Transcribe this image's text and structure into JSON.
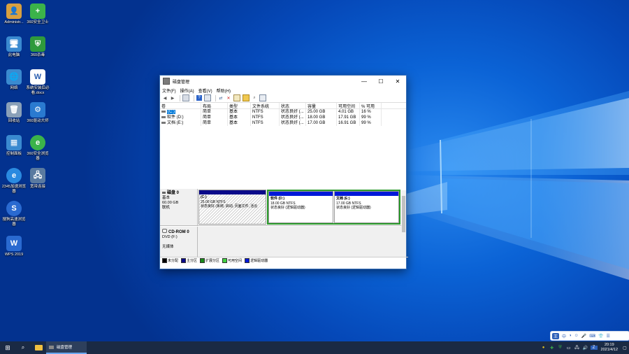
{
  "desktop": {
    "icons": [
      {
        "label": "Administr...",
        "glyph": "👤",
        "color": "#d8a040"
      },
      {
        "label": "360安全卫士",
        "glyph": "+",
        "color": "#3bb34a"
      },
      {
        "label": "此电脑",
        "glyph": "🖥",
        "color": "#3a8ad0"
      },
      {
        "label": "360杀毒",
        "glyph": "⛨",
        "color": "#2f9a3c"
      },
      {
        "label": "网络",
        "glyph": "🌐",
        "color": "#3a8ad0"
      },
      {
        "label": "系统安装后必看.docx",
        "glyph": "W",
        "color": "#2b5fb0"
      },
      {
        "label": "回收站",
        "glyph": "🗑",
        "color": "#8aa0b8"
      },
      {
        "label": "360驱动大师",
        "glyph": "⚙",
        "color": "#2a7ad0"
      },
      {
        "label": "控制面板",
        "glyph": "▦",
        "color": "#3a8ad0"
      },
      {
        "label": "360安全浏览器",
        "glyph": "e",
        "color": "#3bb34a"
      },
      {
        "label": "2345加速浏览器",
        "glyph": "e",
        "color": "#2a8ae0"
      },
      {
        "label": "宽带连接",
        "glyph": "🖧",
        "color": "#5a7aa0"
      },
      {
        "label": "搜狗高速浏览器",
        "glyph": "S",
        "color": "#2a6ad0"
      },
      {
        "label": "WPS 2019",
        "glyph": "W",
        "color": "#2a6ad0"
      }
    ]
  },
  "window": {
    "title": "磁盘管理",
    "controls": {
      "minimize": "—",
      "maximize": "☐",
      "close": "✕"
    },
    "menu": [
      "文件(F)",
      "操作(A)",
      "查看(V)",
      "帮助(H)"
    ],
    "toolbar_icons": [
      "back-icon",
      "forward-icon",
      "sep",
      "list-icon",
      "sep",
      "help-icon",
      "grid-icon",
      "sep",
      "connect-icon",
      "delete-icon",
      "properties-icon",
      "folder-icon",
      "search-icon",
      "view-icon"
    ],
    "table": {
      "headers": [
        "卷",
        "布局",
        "类型",
        "文件系统",
        "状态",
        "容量",
        "可用空间",
        "% 可用"
      ],
      "rows": [
        {
          "name": "(C:)",
          "selected": true,
          "cells": [
            "简单",
            "基本",
            "NTFS",
            "状态良好 (...",
            "25.00 GB",
            "4.01 GB",
            "16 %"
          ]
        },
        {
          "name": "软件 (D:)",
          "selected": false,
          "cells": [
            "简单",
            "基本",
            "NTFS",
            "状态良好 (...",
            "18.00 GB",
            "17.91 GB",
            "99 %"
          ]
        },
        {
          "name": "文档 (E:)",
          "selected": false,
          "cells": [
            "简单",
            "基本",
            "NTFS",
            "状态良好 (...",
            "17.00 GB",
            "16.91 GB",
            "99 %"
          ]
        }
      ]
    },
    "disks": [
      {
        "name": "磁盘 0",
        "type": "基本",
        "size": "60.00 GB",
        "status": "联机",
        "partitions": [
          {
            "title": "(C:)",
            "size": "25.00 GB NTFS",
            "status": "状态良好 (系统, 启动, 页面文件, 活云",
            "color": "#0a0a8a",
            "style": "hatch"
          },
          {
            "title": "软件  (D:)",
            "size": "18.00 GB NTFS",
            "status": "状态良好 (逻辑驱动器)",
            "color": "#0018d8",
            "style": "logical"
          },
          {
            "title": "文档  (E:)",
            "size": "17.00 GB NTFS",
            "status": "状态良好 (逻辑驱动器)",
            "color": "#0018d8",
            "style": "logical"
          }
        ]
      },
      {
        "name": "CD-ROM 0",
        "type": "DVD (F:)",
        "size": "",
        "status": "无媒体",
        "partitions": []
      }
    ],
    "legend": [
      {
        "label": "未分配",
        "color": "#000000"
      },
      {
        "label": "主分区",
        "color": "#0a0a8a"
      },
      {
        "label": "扩展分区",
        "color": "#1a8a1a"
      },
      {
        "label": "可用空间",
        "color": "#40d040"
      },
      {
        "label": "逻辑驱动器",
        "color": "#0018d8"
      }
    ]
  },
  "taskbar": {
    "active_app": "磁盘管理",
    "time": "20:19",
    "date": "2021/4/12"
  },
  "ime": {
    "label": "中"
  }
}
